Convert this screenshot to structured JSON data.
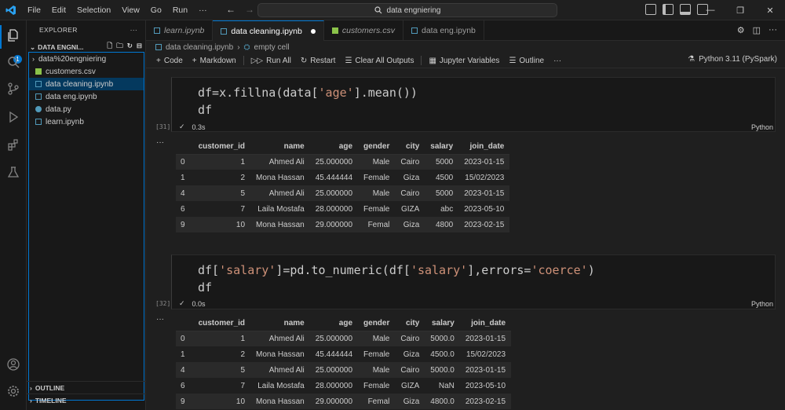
{
  "menu": [
    "File",
    "Edit",
    "Selection",
    "View",
    "Go",
    "Run",
    "···"
  ],
  "search": "data engniering",
  "colors": {
    "accent": "#0078d4",
    "csv": "#8bc34a",
    "notebook": "#519aba",
    "py": "#519aba"
  },
  "activity_badge": "1",
  "explorer": {
    "title": "EXPLORER",
    "section": "DATA ENGNI...",
    "items": [
      {
        "label": "data%20engniering",
        "type": "folder"
      },
      {
        "label": "customers.csv",
        "type": "csv"
      },
      {
        "label": "data cleaning.ipynb",
        "type": "notebook"
      },
      {
        "label": "data eng.ipynb",
        "type": "notebook"
      },
      {
        "label": "data.py",
        "type": "py"
      },
      {
        "label": "learn.ipynb",
        "type": "notebook"
      }
    ],
    "outline": "OUTLINE",
    "timeline": "TIMELINE"
  },
  "tabs": [
    {
      "label": "learn.ipynb",
      "type": "notebook"
    },
    {
      "label": "data cleaning.ipynb",
      "type": "notebook",
      "active": true
    },
    {
      "label": "customers.csv",
      "type": "csv"
    },
    {
      "label": "data eng.ipynb",
      "type": "notebook"
    }
  ],
  "breadcrumb": {
    "file": "data cleaning.ipynb",
    "cell": "empty cell"
  },
  "toolbar": {
    "code": "Code",
    "markdown": "Markdown",
    "run_all": "Run All",
    "restart": "Restart",
    "clear": "Clear All Outputs",
    "variables": "Jupyter Variables",
    "outline": "Outline",
    "more": "···",
    "kernel": "Python 3.11 (PySpark)"
  },
  "cells": [
    {
      "count": "[31]",
      "time": "0.3s",
      "lang": "Python",
      "code_line1": [
        "df=x.fillna(data[",
        "'age'",
        "].mean())"
      ],
      "code_line2": "df",
      "columns": [
        "",
        "customer_id",
        "name",
        "age",
        "gender",
        "city",
        "salary",
        "join_date"
      ],
      "rows": [
        [
          "0",
          "1",
          "Ahmed Ali",
          "25.000000",
          "Male",
          "Cairo",
          "5000",
          "2023-01-15"
        ],
        [
          "1",
          "2",
          "Mona Hassan",
          "45.444444",
          "Female",
          "Giza",
          "4500",
          "15/02/2023"
        ],
        [
          "4",
          "5",
          "Ahmed Ali",
          "25.000000",
          "Male",
          "Cairo",
          "5000",
          "2023-01-15"
        ],
        [
          "6",
          "7",
          "Laila Mostafa",
          "28.000000",
          "Female",
          "GIZA",
          "abc",
          "2023-05-10"
        ],
        [
          "9",
          "10",
          "Mona Hassan",
          "29.000000",
          "Femal",
          "Giza",
          "4800",
          "2023-02-15"
        ]
      ]
    },
    {
      "count": "[32]",
      "time": "0.0s",
      "lang": "Python",
      "code_line1": [
        "df[",
        "'salary'",
        "]=pd.to_numeric(df[",
        "'salary'",
        "],errors=",
        "'coerce'",
        ")"
      ],
      "code_line2": "df",
      "columns": [
        "",
        "customer_id",
        "name",
        "age",
        "gender",
        "city",
        "salary",
        "join_date"
      ],
      "rows": [
        [
          "0",
          "1",
          "Ahmed Ali",
          "25.000000",
          "Male",
          "Cairo",
          "5000.0",
          "2023-01-15"
        ],
        [
          "1",
          "2",
          "Mona Hassan",
          "45.444444",
          "Female",
          "Giza",
          "4500.0",
          "15/02/2023"
        ],
        [
          "4",
          "5",
          "Ahmed Ali",
          "25.000000",
          "Male",
          "Cairo",
          "5000.0",
          "2023-01-15"
        ],
        [
          "6",
          "7",
          "Laila Mostafa",
          "28.000000",
          "Female",
          "GIZA",
          "NaN",
          "2023-05-10"
        ],
        [
          "9",
          "10",
          "Mona Hassan",
          "29.000000",
          "Femal",
          "Giza",
          "4800.0",
          "2023-02-15"
        ]
      ]
    }
  ]
}
